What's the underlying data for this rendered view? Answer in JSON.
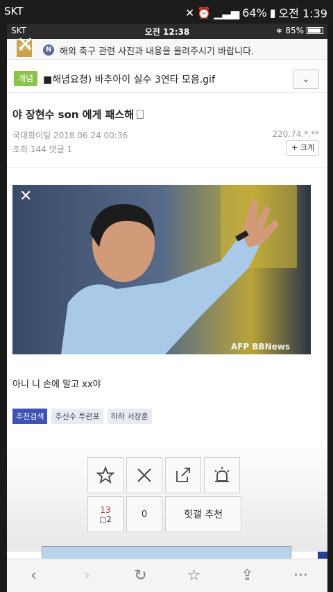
{
  "outer_status": {
    "carrier": "SKT",
    "battery": "64%",
    "time": "오전 1:39"
  },
  "inner_status": {
    "carrier": "SKT",
    "time": "오전 12:38",
    "battery": "85%"
  },
  "notice": {
    "tag": "공지",
    "badge": "N",
    "text": "해외 축구 관련 사진과 내용을 올려주시기 바랍니다."
  },
  "board": {
    "category": "개념",
    "title": "■해념요청) 바추아이 실수 3연타 모음.gif"
  },
  "post": {
    "title": "야 장현수 son 에게 패스해",
    "author_date": "국대화이팅 2018.06.24 00:36",
    "ip": "220.74.*.**",
    "views_comments": "조회 144 댓글 1",
    "bigger_label": "+ 크게",
    "image_watermark": "AFP BBNews",
    "body": "아니 니 손에 말고 xx야"
  },
  "tags": {
    "recommend": "추천검색",
    "items": [
      "추신수 투런포",
      "하하 서장훈"
    ]
  },
  "actions": {
    "count": "13",
    "comment_count": "2",
    "zero": "0",
    "recommend_label": "힛갤 추천"
  },
  "icons": [
    "back-icon",
    "forward-icon",
    "refresh-icon",
    "star-icon",
    "share-icon",
    "more-icon"
  ]
}
